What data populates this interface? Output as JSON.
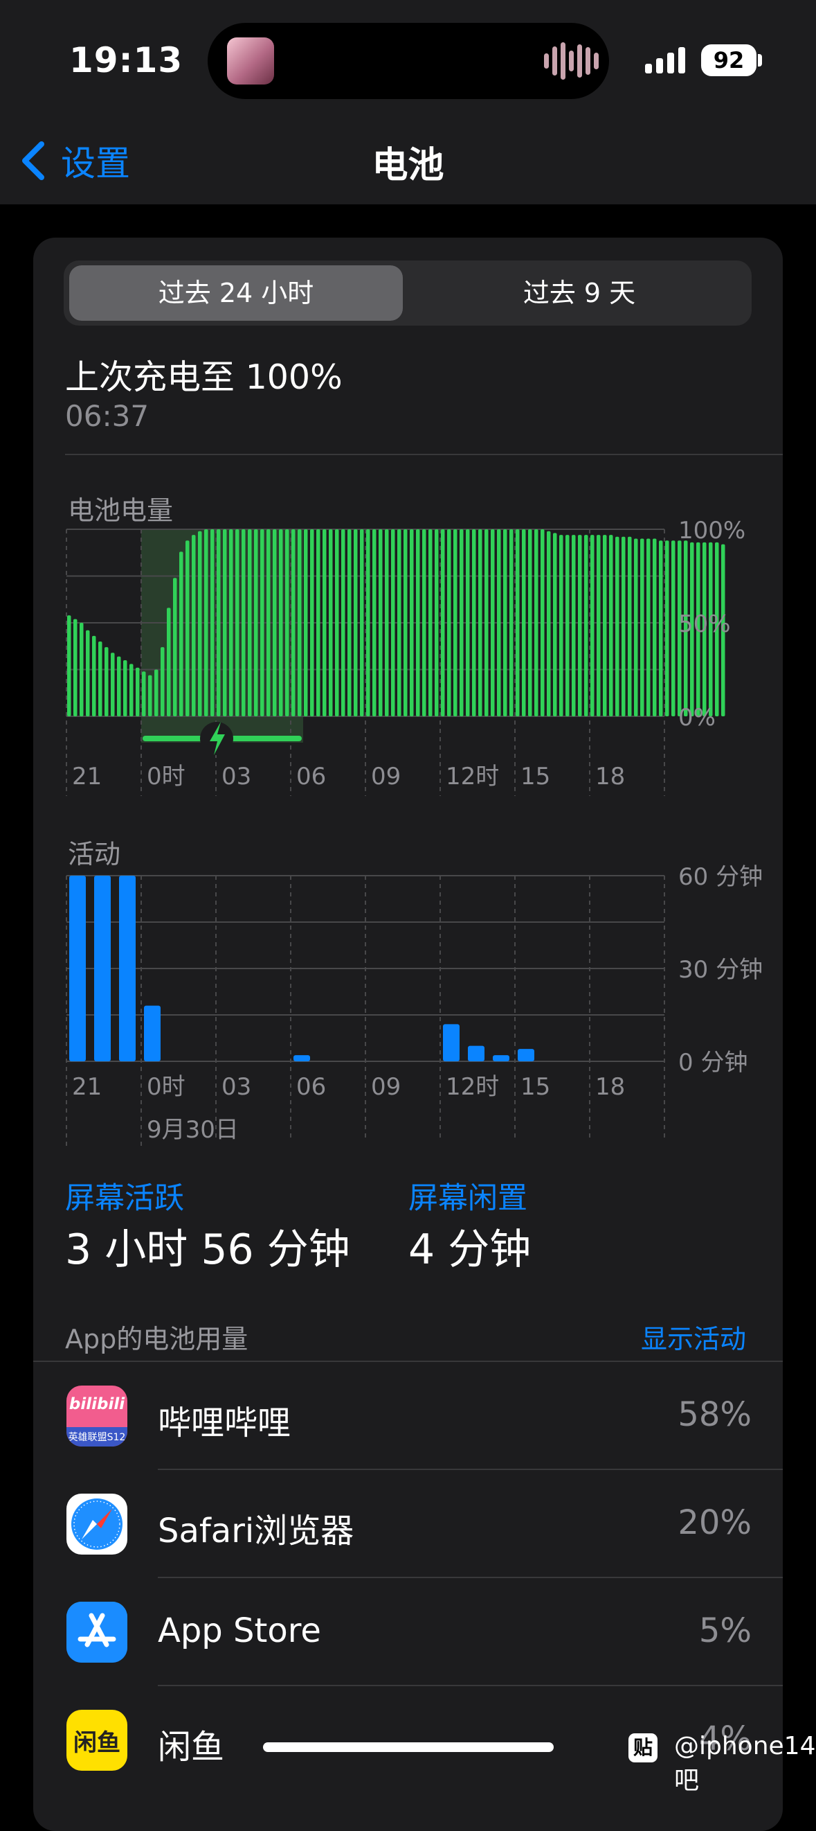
{
  "status_bar": {
    "time": "19:13",
    "battery_percent": "92",
    "signal_bars": 4
  },
  "nav": {
    "back_label": "设置",
    "title": "电池"
  },
  "segment": {
    "options": [
      "过去 24 小时",
      "过去 9 天"
    ],
    "selected": 0
  },
  "last_charge": {
    "label": "上次充电至 100%",
    "time": "06:37"
  },
  "battery_chart_label": "电池电量",
  "activity_chart_label": "活动",
  "date_label": "9月30日",
  "chart_data": [
    {
      "type": "bar",
      "title": "电池电量",
      "x_ticks": [
        "21",
        "0时",
        "03",
        "06",
        "09",
        "12时",
        "15",
        "18"
      ],
      "y_ticks": [
        "100%",
        "50%",
        "0%"
      ],
      "ylim": [
        0,
        100
      ],
      "unit": "%",
      "charging_window": {
        "start_hour": 0,
        "end_hour": 6.5
      },
      "x_start_hour": -3,
      "x_end_hour": 21,
      "interval_hours": 0.25,
      "values": [
        54,
        52,
        50,
        46,
        43,
        40,
        37,
        34,
        32,
        30,
        28,
        26,
        24,
        22,
        25,
        37,
        58,
        74,
        88,
        94,
        97,
        99,
        100,
        100,
        100,
        100,
        100,
        100,
        100,
        100,
        100,
        100,
        100,
        100,
        100,
        100,
        100,
        100,
        100,
        100,
        100,
        100,
        100,
        100,
        100,
        100,
        100,
        100,
        100,
        100,
        100,
        100,
        100,
        100,
        100,
        100,
        100,
        100,
        100,
        100,
        100,
        100,
        100,
        100,
        100,
        100,
        100,
        100,
        100,
        100,
        100,
        100,
        100,
        100,
        100,
        100,
        100,
        99,
        98,
        97,
        97,
        97,
        97,
        97,
        97,
        97,
        97,
        97,
        96,
        96,
        96,
        95,
        95,
        95,
        95,
        94,
        94,
        94,
        94,
        94,
        93,
        93,
        93,
        93,
        93,
        92
      ],
      "grid": true
    },
    {
      "type": "bar",
      "title": "活动",
      "x_ticks": [
        "21",
        "0时",
        "03",
        "06",
        "09",
        "12时",
        "15",
        "18"
      ],
      "y_ticks": [
        "60 分钟",
        "30 分钟",
        "0 分钟"
      ],
      "ylim": [
        0,
        60
      ],
      "unit": "分钟",
      "x_start_hour": -3,
      "bars": [
        {
          "hour": -3,
          "minutes": 60
        },
        {
          "hour": -2,
          "minutes": 60
        },
        {
          "hour": -1,
          "minutes": 60
        },
        {
          "hour": 0,
          "minutes": 18
        },
        {
          "hour": 6,
          "minutes": 2
        },
        {
          "hour": 12,
          "minutes": 12
        },
        {
          "hour": 13,
          "minutes": 5
        },
        {
          "hour": 14,
          "minutes": 2
        },
        {
          "hour": 15,
          "minutes": 4
        }
      ],
      "grid": true
    }
  ],
  "screen_on": {
    "label": "屏幕活跃",
    "value": "3 小时 56 分钟"
  },
  "screen_idle": {
    "label": "屏幕闲置",
    "value": "4 分钟"
  },
  "apps_header": "App的电池用量",
  "show_activity": "显示活动",
  "apps": [
    {
      "name": "哔哩哔哩",
      "percent": "58%",
      "icon_text": "bilibili",
      "icon_sub": "英雄联盟S12",
      "icon": "bilibili-icon"
    },
    {
      "name": "Safari浏览器",
      "percent": "20%",
      "icon": "safari-icon"
    },
    {
      "name": "App Store",
      "percent": "5%",
      "icon": "app-store-icon"
    },
    {
      "name": "闲鱼",
      "percent": "4%",
      "icon_text": "闲鱼",
      "icon": "xianyu-icon"
    }
  ],
  "watermark": {
    "icon_text": "贴",
    "text": "@iphone14吧"
  },
  "colors": {
    "accent": "#0a84ff",
    "battery_green": "#30d158",
    "activity_blue": "#0a84ff",
    "charging_overlay": "#2d4a32",
    "background": "#000000",
    "card": "#1c1c1e"
  }
}
